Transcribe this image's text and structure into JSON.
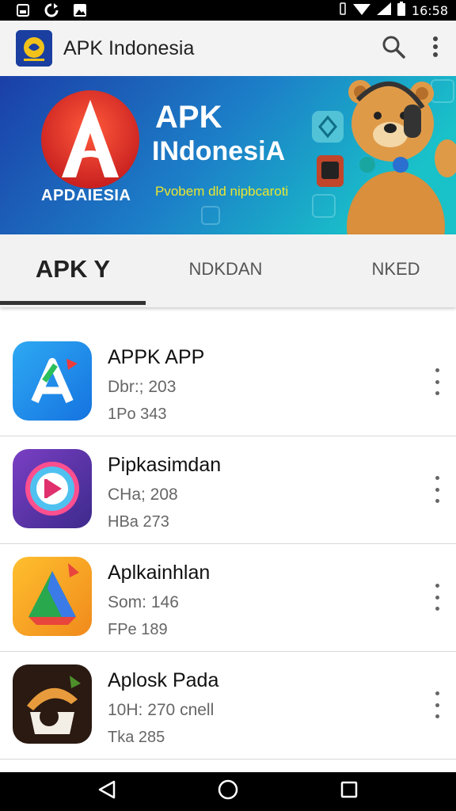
{
  "status_bar": {
    "time": "16:58"
  },
  "app_bar": {
    "title": "APK Indonesia"
  },
  "banner": {
    "brand_line1": "APK",
    "brand_line2": "INdonesiA",
    "tagline": "Pvobem dld nipbcaroti",
    "logo_caption": "APDAIESIA"
  },
  "tabs": [
    {
      "label": "APK Y",
      "active": true
    },
    {
      "label": "NDKDAN",
      "active": false
    },
    {
      "label": "NKED",
      "active": false
    }
  ],
  "apps": [
    {
      "name": "APPK APP",
      "meta1": "Dbr:; 203",
      "meta2": "1Po   343"
    },
    {
      "name": "Pipkasimdan",
      "meta1": "CHa; 208",
      "meta2": "HBa   273"
    },
    {
      "name": "Aplkainhlan",
      "meta1": "Som: 146",
      "meta2": "FPe   189"
    },
    {
      "name": "Aplosk Pada",
      "meta1": "10H: 270 cnell",
      "meta2": "Tka   285"
    }
  ],
  "colors": {
    "banner_start": "#1b3fa8",
    "banner_end": "#18b6c9",
    "accent_red": "#e23a2e"
  }
}
